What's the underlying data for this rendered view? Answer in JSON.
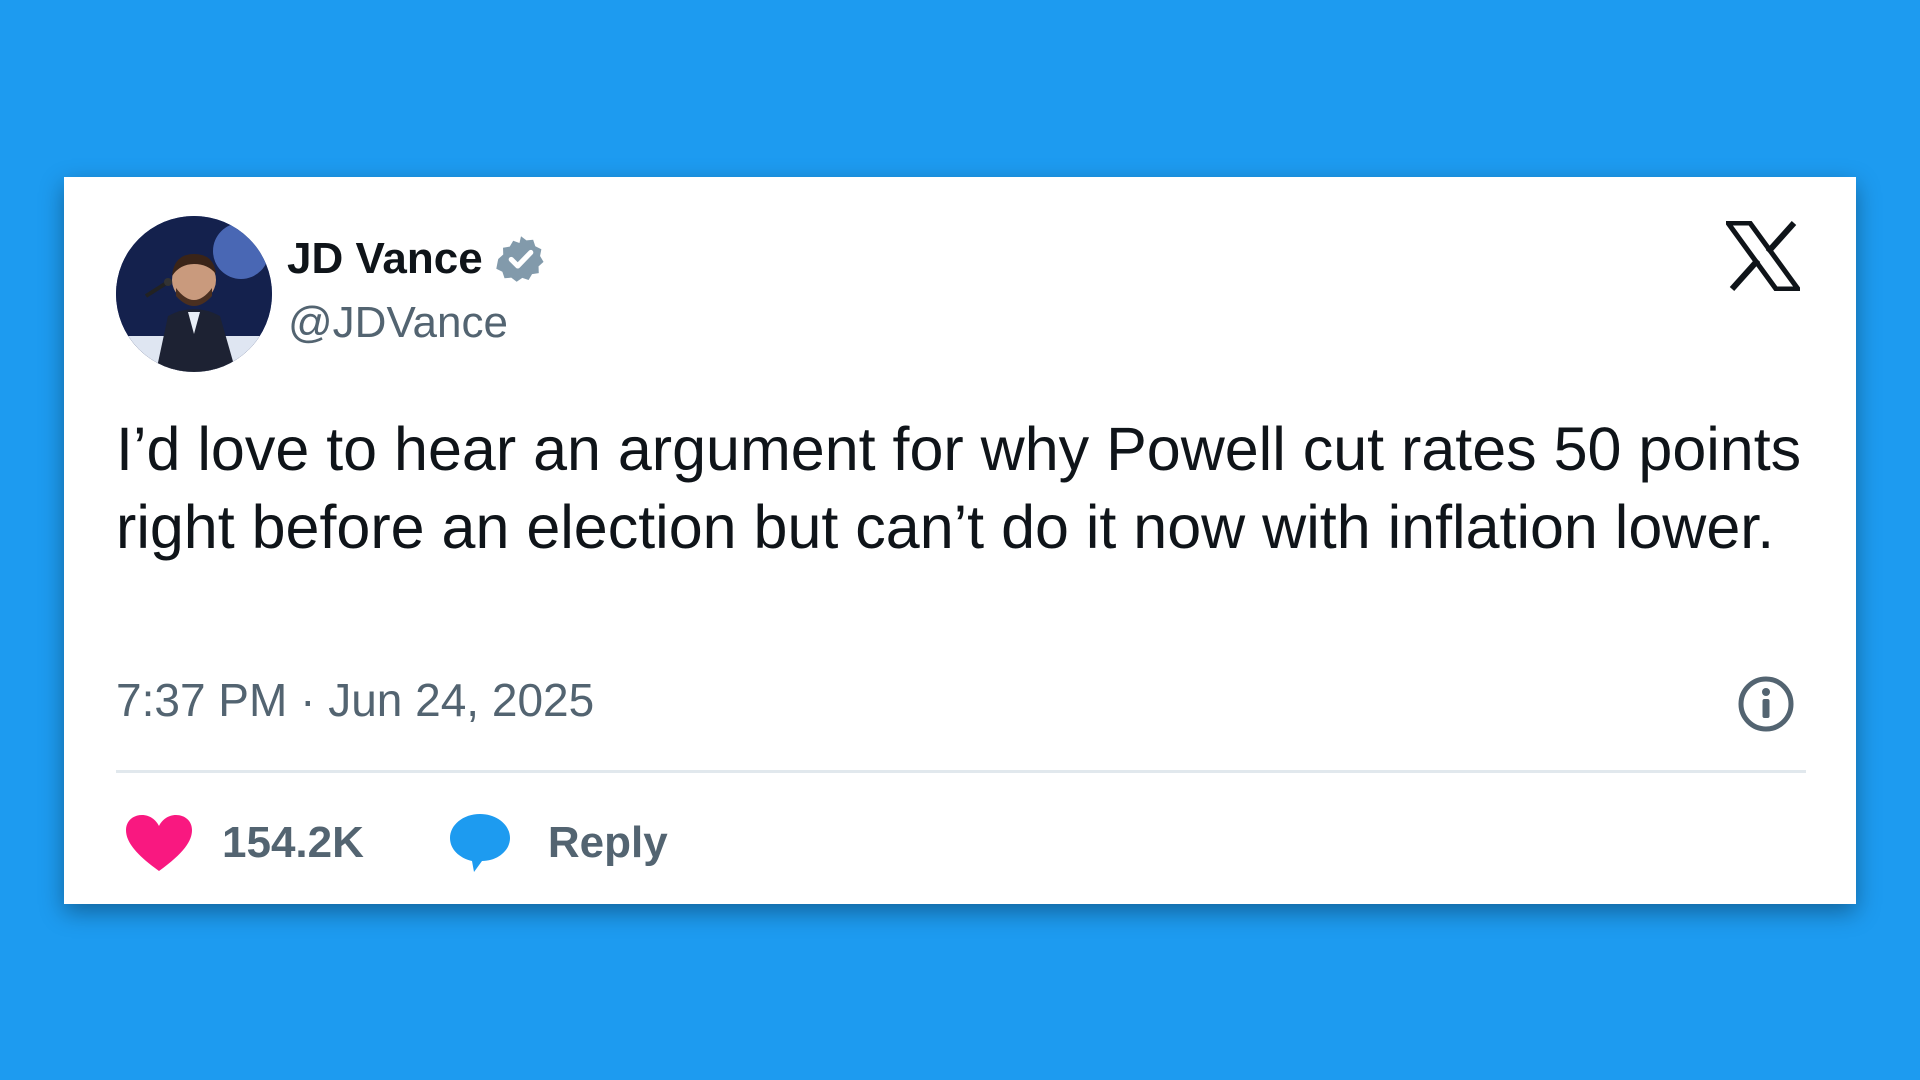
{
  "background_color": "#1d9bf0",
  "tweet": {
    "author": {
      "display_name": "JD Vance",
      "handle": "@JDVance",
      "verified": true,
      "verified_color": "#829aab",
      "avatar_icon": "profile-photo"
    },
    "platform_logo": "x-logo",
    "text": "I’d love to hear an argument for why Powell cut rates 50 points right before an election but can’t do it now with inflation lower.",
    "timestamp": "7:37 PM · Jun 24, 2025",
    "info_icon": "info-icon",
    "actions": {
      "like_count": "154.2K",
      "like_icon": "heart-icon",
      "like_color": "#f91880",
      "reply_label": "Reply",
      "reply_icon": "speech-bubble-icon",
      "reply_color": "#1d9bf0"
    }
  }
}
